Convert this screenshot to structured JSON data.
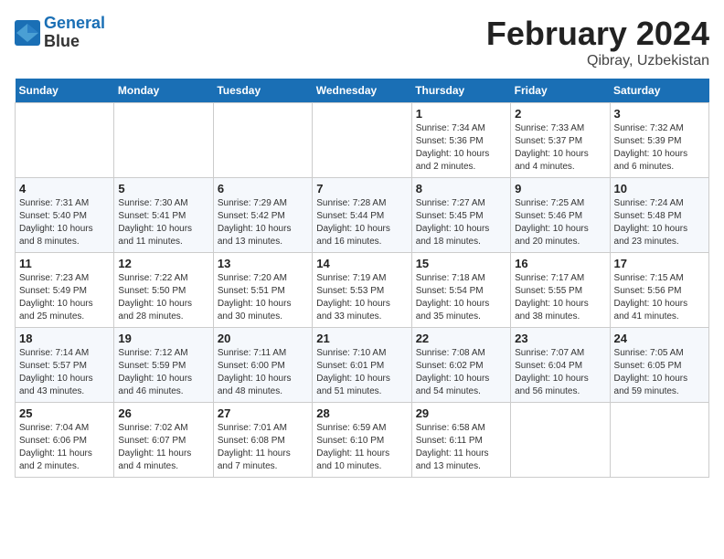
{
  "header": {
    "logo_line1": "General",
    "logo_line2": "Blue",
    "title": "February 2024",
    "subtitle": "Qibray, Uzbekistan"
  },
  "days_of_week": [
    "Sunday",
    "Monday",
    "Tuesday",
    "Wednesday",
    "Thursday",
    "Friday",
    "Saturday"
  ],
  "weeks": [
    [
      {
        "day": "",
        "info": ""
      },
      {
        "day": "",
        "info": ""
      },
      {
        "day": "",
        "info": ""
      },
      {
        "day": "",
        "info": ""
      },
      {
        "day": "1",
        "info": "Sunrise: 7:34 AM\nSunset: 5:36 PM\nDaylight: 10 hours\nand 2 minutes."
      },
      {
        "day": "2",
        "info": "Sunrise: 7:33 AM\nSunset: 5:37 PM\nDaylight: 10 hours\nand 4 minutes."
      },
      {
        "day": "3",
        "info": "Sunrise: 7:32 AM\nSunset: 5:39 PM\nDaylight: 10 hours\nand 6 minutes."
      }
    ],
    [
      {
        "day": "4",
        "info": "Sunrise: 7:31 AM\nSunset: 5:40 PM\nDaylight: 10 hours\nand 8 minutes."
      },
      {
        "day": "5",
        "info": "Sunrise: 7:30 AM\nSunset: 5:41 PM\nDaylight: 10 hours\nand 11 minutes."
      },
      {
        "day": "6",
        "info": "Sunrise: 7:29 AM\nSunset: 5:42 PM\nDaylight: 10 hours\nand 13 minutes."
      },
      {
        "day": "7",
        "info": "Sunrise: 7:28 AM\nSunset: 5:44 PM\nDaylight: 10 hours\nand 16 minutes."
      },
      {
        "day": "8",
        "info": "Sunrise: 7:27 AM\nSunset: 5:45 PM\nDaylight: 10 hours\nand 18 minutes."
      },
      {
        "day": "9",
        "info": "Sunrise: 7:25 AM\nSunset: 5:46 PM\nDaylight: 10 hours\nand 20 minutes."
      },
      {
        "day": "10",
        "info": "Sunrise: 7:24 AM\nSunset: 5:48 PM\nDaylight: 10 hours\nand 23 minutes."
      }
    ],
    [
      {
        "day": "11",
        "info": "Sunrise: 7:23 AM\nSunset: 5:49 PM\nDaylight: 10 hours\nand 25 minutes."
      },
      {
        "day": "12",
        "info": "Sunrise: 7:22 AM\nSunset: 5:50 PM\nDaylight: 10 hours\nand 28 minutes."
      },
      {
        "day": "13",
        "info": "Sunrise: 7:20 AM\nSunset: 5:51 PM\nDaylight: 10 hours\nand 30 minutes."
      },
      {
        "day": "14",
        "info": "Sunrise: 7:19 AM\nSunset: 5:53 PM\nDaylight: 10 hours\nand 33 minutes."
      },
      {
        "day": "15",
        "info": "Sunrise: 7:18 AM\nSunset: 5:54 PM\nDaylight: 10 hours\nand 35 minutes."
      },
      {
        "day": "16",
        "info": "Sunrise: 7:17 AM\nSunset: 5:55 PM\nDaylight: 10 hours\nand 38 minutes."
      },
      {
        "day": "17",
        "info": "Sunrise: 7:15 AM\nSunset: 5:56 PM\nDaylight: 10 hours\nand 41 minutes."
      }
    ],
    [
      {
        "day": "18",
        "info": "Sunrise: 7:14 AM\nSunset: 5:57 PM\nDaylight: 10 hours\nand 43 minutes."
      },
      {
        "day": "19",
        "info": "Sunrise: 7:12 AM\nSunset: 5:59 PM\nDaylight: 10 hours\nand 46 minutes."
      },
      {
        "day": "20",
        "info": "Sunrise: 7:11 AM\nSunset: 6:00 PM\nDaylight: 10 hours\nand 48 minutes."
      },
      {
        "day": "21",
        "info": "Sunrise: 7:10 AM\nSunset: 6:01 PM\nDaylight: 10 hours\nand 51 minutes."
      },
      {
        "day": "22",
        "info": "Sunrise: 7:08 AM\nSunset: 6:02 PM\nDaylight: 10 hours\nand 54 minutes."
      },
      {
        "day": "23",
        "info": "Sunrise: 7:07 AM\nSunset: 6:04 PM\nDaylight: 10 hours\nand 56 minutes."
      },
      {
        "day": "24",
        "info": "Sunrise: 7:05 AM\nSunset: 6:05 PM\nDaylight: 10 hours\nand 59 minutes."
      }
    ],
    [
      {
        "day": "25",
        "info": "Sunrise: 7:04 AM\nSunset: 6:06 PM\nDaylight: 11 hours\nand 2 minutes."
      },
      {
        "day": "26",
        "info": "Sunrise: 7:02 AM\nSunset: 6:07 PM\nDaylight: 11 hours\nand 4 minutes."
      },
      {
        "day": "27",
        "info": "Sunrise: 7:01 AM\nSunset: 6:08 PM\nDaylight: 11 hours\nand 7 minutes."
      },
      {
        "day": "28",
        "info": "Sunrise: 6:59 AM\nSunset: 6:10 PM\nDaylight: 11 hours\nand 10 minutes."
      },
      {
        "day": "29",
        "info": "Sunrise: 6:58 AM\nSunset: 6:11 PM\nDaylight: 11 hours\nand 13 minutes."
      },
      {
        "day": "",
        "info": ""
      },
      {
        "day": "",
        "info": ""
      }
    ]
  ]
}
